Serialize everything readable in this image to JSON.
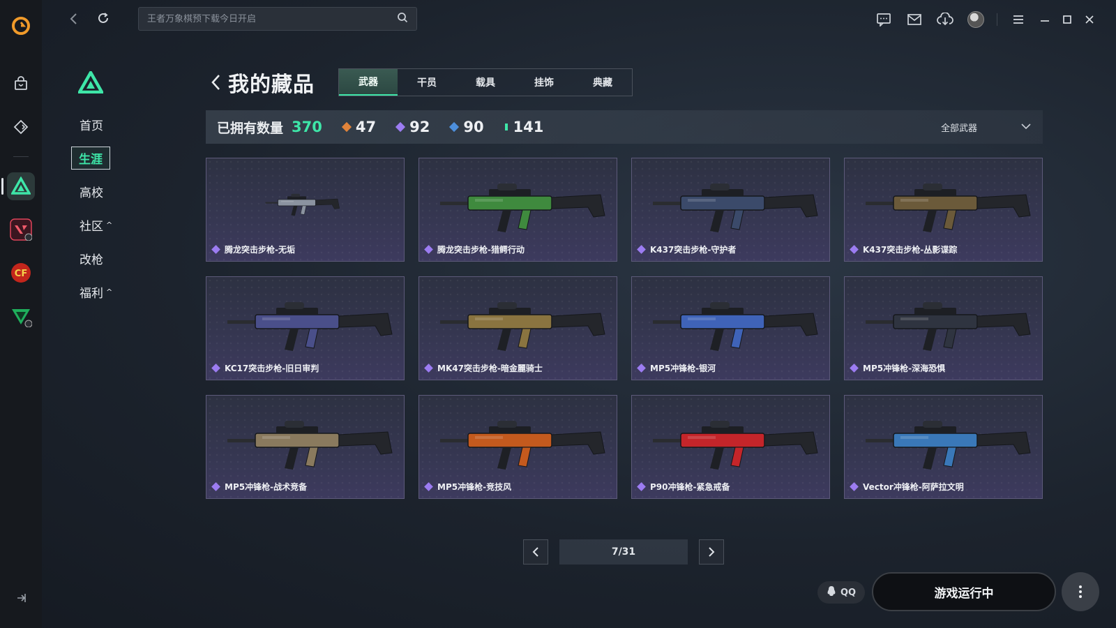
{
  "search": {
    "placeholder": "王者万象棋预下载今日开启"
  },
  "sidenav": {
    "items": [
      {
        "label": "首页"
      },
      {
        "label": "生涯"
      },
      {
        "label": "高校"
      },
      {
        "label": "社区",
        "chevron": "^"
      },
      {
        "label": "改枪"
      },
      {
        "label": "福利",
        "chevron": "^"
      }
    ]
  },
  "page": {
    "title": "我的藏品"
  },
  "tabs": [
    {
      "label": "武器"
    },
    {
      "label": "干员"
    },
    {
      "label": "载具"
    },
    {
      "label": "挂饰"
    },
    {
      "label": "典藏"
    }
  ],
  "stats": {
    "owned_label": "已拥有数量",
    "owned_count": "370",
    "rarities": [
      {
        "count": "47",
        "color": "#e0833a"
      },
      {
        "count": "92",
        "color": "#9c7cf2"
      },
      {
        "count": "90",
        "color": "#4d8fdc"
      },
      {
        "count": "141",
        "color": "#3ee6a8"
      }
    ]
  },
  "filter": {
    "label": "全部武器"
  },
  "items": [
    {
      "name": "腾龙突击步枪-无垢",
      "accent": "#8b93a0"
    },
    {
      "name": "腾龙突击步枪-猎鳄行动",
      "accent": "#3f8a3e"
    },
    {
      "name": "K437突击步枪-守护者",
      "accent": "#3b4a6a"
    },
    {
      "name": "K437突击步枪-丛影谍踪",
      "accent": "#6b5a3a"
    },
    {
      "name": "KC17突击步枪-旧日审判",
      "accent": "#4a4f8a"
    },
    {
      "name": "MK47突击步枪-暗金麗骑士",
      "accent": "#8a7440"
    },
    {
      "name": "MP5冲锋枪-银河",
      "accent": "#3f63b8"
    },
    {
      "name": "MP5冲锋枪-深海恐惧",
      "accent": "#2f3440"
    },
    {
      "name": "MP5冲锋枪-战术竞备",
      "accent": "#8a7a5e"
    },
    {
      "name": "MP5冲锋枪-竞技风",
      "accent": "#c45a1e"
    },
    {
      "name": "P90冲锋枪-紧急戒备",
      "accent": "#c4252a"
    },
    {
      "name": "Vector冲锋枪-阿萨拉文明",
      "accent": "#3a78b8"
    }
  ],
  "pager": {
    "text": "7/31"
  },
  "bottom": {
    "qq_label": "QQ",
    "launch_label": "游戏运行中"
  }
}
